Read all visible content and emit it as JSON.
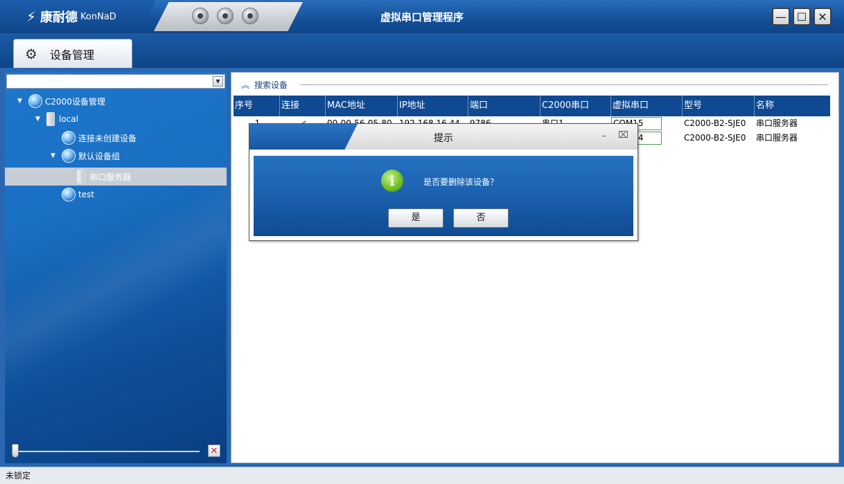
{
  "window": {
    "title": "虚拟串口管理程序",
    "logo_mark": "⚡",
    "logo_cn": "康耐德",
    "logo_en": "KonNaD",
    "minimize": "—",
    "maximize": "☐",
    "close": "✕"
  },
  "tabs": [
    {
      "label": "设备管理",
      "icon": "gear-icon"
    }
  ],
  "tree": {
    "combo_value": "",
    "items": [
      {
        "label": "C2000设备管理",
        "level": 0,
        "icon": "globe-icon",
        "expanded": true
      },
      {
        "label": "local",
        "level": 1,
        "icon": "server-icon",
        "expanded": true
      },
      {
        "label": "连接未创建设备",
        "level": 2,
        "icon": "globe-icon"
      },
      {
        "label": "默认设备组",
        "level": 2,
        "icon": "globe-icon",
        "expanded": true
      },
      {
        "label": "串口服务器",
        "level": 3,
        "icon": "server-check-icon",
        "selected": true
      },
      {
        "label": "test",
        "level": 1,
        "icon": "globe-icon"
      }
    ]
  },
  "search": {
    "label": "搜索设备"
  },
  "table": {
    "columns": [
      "序号",
      "连接",
      "MAC地址",
      "IP地址",
      "端口",
      "C2000串口",
      "虚拟串口",
      "型号",
      "名称"
    ],
    "rows": [
      {
        "index": "1",
        "connected": "✔",
        "mac": "00-00-56-05-80",
        "ip": "192.168.16.44",
        "port": "9786",
        "c2000_port": "串口1",
        "virtual_port": "COM15",
        "model": "C2000-B2-SJE0",
        "name": "串口服务器"
      },
      {
        "index": "",
        "connected": "",
        "mac": "",
        "ip": "",
        "port": "",
        "c2000_port": "",
        "virtual_port": "COM14",
        "model": "C2000-B2-SJE0",
        "name": "串口服务器"
      }
    ]
  },
  "dialog": {
    "title": "提示",
    "message": "是否要删除该设备？",
    "yes": "是",
    "no": "否",
    "minimize": "–",
    "close": "⌧"
  },
  "status": {
    "text": "未锁定"
  }
}
